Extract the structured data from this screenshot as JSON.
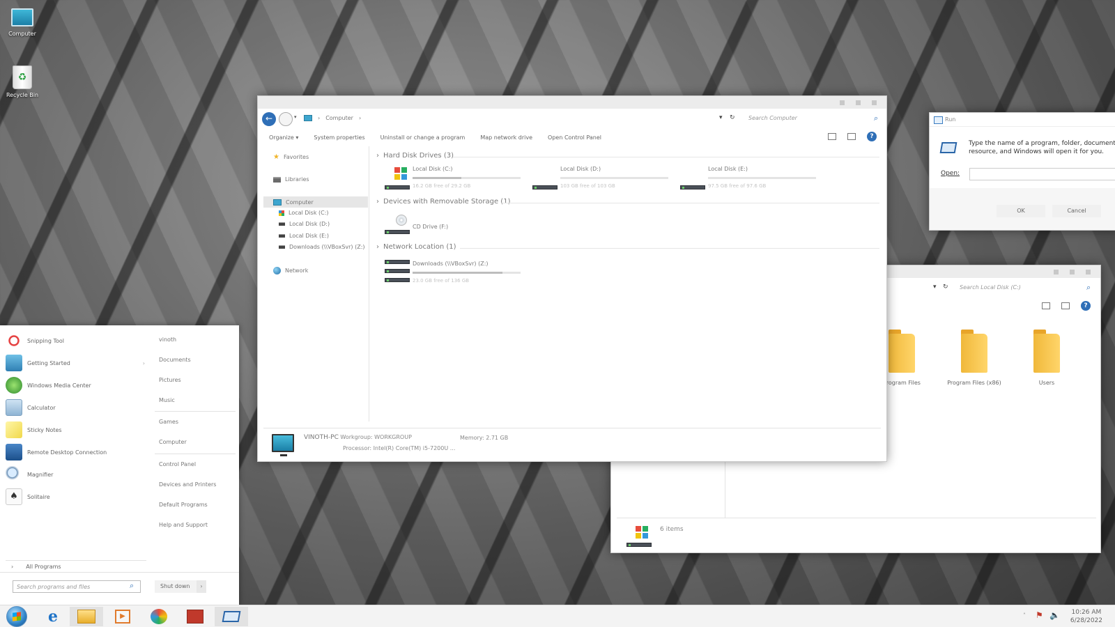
{
  "desktop": {
    "icons": [
      {
        "label": "Computer"
      },
      {
        "label": "Recycle Bin"
      }
    ]
  },
  "explorer": {
    "breadcrumb": "Computer",
    "search_placeholder": "Search Computer",
    "toolbar": [
      "Organize",
      "System properties",
      "Uninstall or change a program",
      "Map network drive",
      "Open Control Panel"
    ],
    "nav": {
      "favorites": "Favorites",
      "libraries": "Libraries",
      "computer": "Computer",
      "drives": [
        "Local Disk (C:)",
        "Local Disk (D:)",
        "Local Disk (E:)",
        "Downloads (\\\\VBoxSvr) (Z:)"
      ],
      "network": "Network"
    },
    "groups": {
      "hdd": "Hard Disk Drives (3)",
      "removable": "Devices with Removable Storage (1)",
      "network": "Network Location (1)"
    },
    "drives": [
      {
        "name": "Local Disk (C:)",
        "free": "16.2 GB free of 29.2 GB",
        "used_fraction": 0.45
      },
      {
        "name": "Local Disk (D:)",
        "free": "103 GB free of 103 GB",
        "used_fraction": 0.0
      },
      {
        "name": "Local Disk (E:)",
        "free": "97.5 GB free of 97.6 GB",
        "used_fraction": 0.0
      }
    ],
    "cd": {
      "name": "CD Drive (F:)"
    },
    "netdrive": {
      "name": "Downloads (\\\\VBoxSvr) (Z:)",
      "free": "23.0 GB free of 136 GB",
      "used_fraction": 0.83
    },
    "details": {
      "pc_name": "VINOTH-PC",
      "workgroup_label": "Workgroup:",
      "workgroup": "WORKGROUP",
      "memory_label": "Memory:",
      "memory": "2.71 GB",
      "processor_label": "Processor:",
      "processor": "Intel(R) Core(TM) i5-7200U ..."
    }
  },
  "run": {
    "title": "Run",
    "description": "Type the name of a program, folder, document, or Internet resource, and Windows will open it for you.",
    "open_label": "Open:",
    "ok": "OK",
    "cancel": "Cancel"
  },
  "explorer2": {
    "search_placeholder": "Search Local Disk (C:)",
    "folders": [
      "Program Files",
      "Program Files (x86)",
      "Users"
    ],
    "status": "6 items"
  },
  "startmenu": {
    "programs": [
      "Snipping Tool",
      "Getting Started",
      "Windows Media Center",
      "Calculator",
      "Sticky Notes",
      "Remote Desktop Connection",
      "Magnifier",
      "Solitaire"
    ],
    "all_programs": "All Programs",
    "right": [
      "vinoth",
      "Documents",
      "Pictures",
      "Music",
      "Games",
      "Computer",
      "Control Panel",
      "Devices and Printers",
      "Default Programs",
      "Help and Support"
    ],
    "search_placeholder": "Search programs and files",
    "shutdown": "Shut down"
  },
  "taskbar": {
    "time": "10:26 AM",
    "date": "6/28/2022"
  },
  "colors": {
    "accent": "#2f6fb7",
    "folder": "#f5c04a"
  }
}
